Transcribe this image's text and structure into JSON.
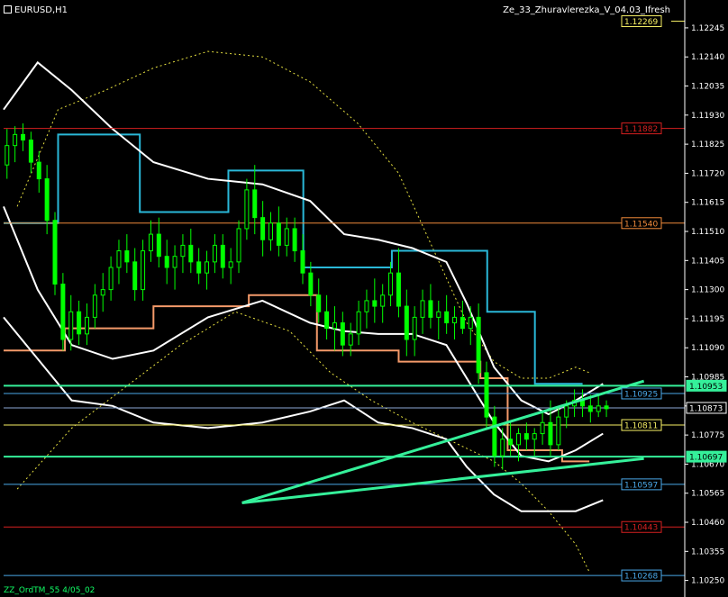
{
  "header": {
    "symbol": "EURUSD,H1",
    "indicator": "Ze_33_Zhuravlerezka_V_04.03_Ifresh"
  },
  "footer": {
    "label": "ZZ_OrdTM_55 4/05_02"
  },
  "colors": {
    "background": "#000000",
    "candle": "#00ff00",
    "price_line": "#8da9d4",
    "level_red": "#d62020",
    "level_orange": "#f08a3a",
    "level_yellow": "#f7f065",
    "level_blue": "#4aa8e8",
    "level_green": "#35f09a",
    "cyan_step": "#2ab8d8",
    "orange_step": "#f49a6a",
    "yellow_marker": "#ffff00",
    "envelope": "#ffffff",
    "dotted": "#e6e040",
    "trend": "#35f09a"
  },
  "chart_data": {
    "type": "candlestick",
    "symbol": "EURUSD",
    "timeframe": "H1",
    "ylim": [
      1.102,
      1.123
    ],
    "yticks": [
      "1.12245",
      "1.12140",
      "1.12035",
      "1.11930",
      "1.11825",
      "1.11720",
      "1.11615",
      "1.11510",
      "1.11405",
      "1.11300",
      "1.11195",
      "1.11090",
      "1.10985",
      "1.10880",
      "1.10775",
      "1.10670",
      "1.10565",
      "1.10460",
      "1.10355",
      "1.10250"
    ],
    "current_price": "1.10873",
    "price_labels": [
      {
        "value": "1.12269",
        "color": "#f7f065"
      },
      {
        "value": "1.11882",
        "color": "#d62020"
      },
      {
        "value": "1.11540",
        "color": "#f08a3a"
      },
      {
        "value": "1.10953",
        "color": "#35f09a"
      },
      {
        "value": "1.10925",
        "color": "#4aa8e8"
      },
      {
        "value": "1.10873",
        "color": "#ffffff"
      },
      {
        "value": "1.10811",
        "color": "#f7f065"
      },
      {
        "value": "1.10697",
        "color": "#35f09a"
      },
      {
        "value": "1.10597",
        "color": "#4aa8e8"
      },
      {
        "value": "1.10443",
        "color": "#d62020"
      },
      {
        "value": "1.10268",
        "color": "#4aa8e8"
      }
    ],
    "levels": [
      {
        "price": 1.12269,
        "color": "#f7f065",
        "style": "solid",
        "from": 0.98
      },
      {
        "price": 1.11882,
        "color": "#d62020",
        "style": "solid"
      },
      {
        "price": 1.1154,
        "color": "#f08a3a",
        "style": "solid"
      },
      {
        "price": 1.10953,
        "color": "#35f09a",
        "style": "solid"
      },
      {
        "price": 1.10925,
        "color": "#4aa8e8",
        "style": "solid"
      },
      {
        "price": 1.10873,
        "color": "#8da9d4",
        "style": "solid"
      },
      {
        "price": 1.10811,
        "color": "#f7f065",
        "style": "solid"
      },
      {
        "price": 1.10697,
        "color": "#35f09a",
        "style": "solid"
      },
      {
        "price": 1.10597,
        "color": "#4aa8e8",
        "style": "solid"
      },
      {
        "price": 1.10443,
        "color": "#d62020",
        "style": "solid"
      },
      {
        "price": 1.10268,
        "color": "#4aa8e8",
        "style": "solid"
      }
    ],
    "candles": [
      [
        1.1175,
        1.1188,
        1.117,
        1.1182
      ],
      [
        1.1182,
        1.1189,
        1.1176,
        1.1186
      ],
      [
        1.1186,
        1.119,
        1.118,
        1.1184
      ],
      [
        1.1184,
        1.1187,
        1.1172,
        1.1176
      ],
      [
        1.1176,
        1.118,
        1.1165,
        1.117
      ],
      [
        1.117,
        1.1175,
        1.115,
        1.1155
      ],
      [
        1.1155,
        1.1158,
        1.1128,
        1.1132
      ],
      [
        1.1132,
        1.1136,
        1.1108,
        1.1112
      ],
      [
        1.1112,
        1.1128,
        1.1108,
        1.1122
      ],
      [
        1.1122,
        1.1126,
        1.111,
        1.1114
      ],
      [
        1.1114,
        1.1125,
        1.111,
        1.112
      ],
      [
        1.112,
        1.1132,
        1.1116,
        1.1128
      ],
      [
        1.1128,
        1.1136,
        1.1122,
        1.113
      ],
      [
        1.113,
        1.1142,
        1.1126,
        1.1138
      ],
      [
        1.1138,
        1.1148,
        1.1132,
        1.1144
      ],
      [
        1.1144,
        1.115,
        1.1136,
        1.114
      ],
      [
        1.114,
        1.1145,
        1.1126,
        1.113
      ],
      [
        1.113,
        1.1148,
        1.1126,
        1.1144
      ],
      [
        1.1144,
        1.1155,
        1.114,
        1.115
      ],
      [
        1.115,
        1.1156,
        1.1138,
        1.1142
      ],
      [
        1.1142,
        1.1148,
        1.1132,
        1.1138
      ],
      [
        1.1138,
        1.1146,
        1.113,
        1.1142
      ],
      [
        1.1142,
        1.115,
        1.1136,
        1.1146
      ],
      [
        1.1146,
        1.1152,
        1.1136,
        1.114
      ],
      [
        1.114,
        1.1145,
        1.1132,
        1.1136
      ],
      [
        1.1136,
        1.1144,
        1.113,
        1.114
      ],
      [
        1.114,
        1.115,
        1.1136,
        1.1146
      ],
      [
        1.1146,
        1.115,
        1.1134,
        1.1138
      ],
      [
        1.1138,
        1.1145,
        1.1132,
        1.114
      ],
      [
        1.114,
        1.1155,
        1.1136,
        1.1152
      ],
      [
        1.1152,
        1.117,
        1.1148,
        1.1166
      ],
      [
        1.1166,
        1.1175,
        1.115,
        1.1156
      ],
      [
        1.1156,
        1.1162,
        1.1142,
        1.1148
      ],
      [
        1.1148,
        1.1158,
        1.1144,
        1.1154
      ],
      [
        1.1154,
        1.116,
        1.1142,
        1.1146
      ],
      [
        1.1146,
        1.1156,
        1.1142,
        1.1152
      ],
      [
        1.1152,
        1.1156,
        1.114,
        1.1144
      ],
      [
        1.1144,
        1.115,
        1.1132,
        1.1136
      ],
      [
        1.1136,
        1.114,
        1.1124,
        1.1128
      ],
      [
        1.1128,
        1.1134,
        1.1118,
        1.1122
      ],
      [
        1.1122,
        1.1128,
        1.1112,
        1.1116
      ],
      [
        1.1116,
        1.1124,
        1.1108,
        1.1118
      ],
      [
        1.1118,
        1.1122,
        1.1106,
        1.111
      ],
      [
        1.111,
        1.1118,
        1.1106,
        1.1114
      ],
      [
        1.1114,
        1.1126,
        1.111,
        1.1122
      ],
      [
        1.1122,
        1.113,
        1.1116,
        1.1126
      ],
      [
        1.1126,
        1.1134,
        1.1118,
        1.1124
      ],
      [
        1.1124,
        1.1132,
        1.1118,
        1.1128
      ],
      [
        1.1128,
        1.114,
        1.1124,
        1.1136
      ],
      [
        1.1136,
        1.1145,
        1.112,
        1.1124
      ],
      [
        1.1124,
        1.113,
        1.1106,
        1.1112
      ],
      [
        1.1112,
        1.1124,
        1.1106,
        1.112
      ],
      [
        1.112,
        1.113,
        1.1114,
        1.1126
      ],
      [
        1.1126,
        1.1132,
        1.1116,
        1.112
      ],
      [
        1.112,
        1.1126,
        1.1112,
        1.1122
      ],
      [
        1.1122,
        1.1128,
        1.1114,
        1.1118
      ],
      [
        1.1118,
        1.1124,
        1.1112,
        1.112
      ],
      [
        1.112,
        1.1126,
        1.1114,
        1.1116
      ],
      [
        1.1116,
        1.1124,
        1.111,
        1.112
      ],
      [
        1.112,
        1.1125,
        1.1096,
        1.11
      ],
      [
        1.11,
        1.1104,
        1.108,
        1.1084
      ],
      [
        1.1084,
        1.1088,
        1.1066,
        1.107
      ],
      [
        1.107,
        1.108,
        1.1065,
        1.1076
      ],
      [
        1.1076,
        1.1082,
        1.107,
        1.1074
      ],
      [
        1.1074,
        1.108,
        1.1068,
        1.1078
      ],
      [
        1.1078,
        1.1082,
        1.1072,
        1.1076
      ],
      [
        1.1076,
        1.108,
        1.107,
        1.1078
      ],
      [
        1.1078,
        1.1086,
        1.1074,
        1.1082
      ],
      [
        1.1082,
        1.109,
        1.107,
        1.1074
      ],
      [
        1.1074,
        1.1088,
        1.1072,
        1.1084
      ],
      [
        1.1084,
        1.109,
        1.108,
        1.1088
      ],
      [
        1.1088,
        1.1094,
        1.1084,
        1.109
      ],
      [
        1.109,
        1.1094,
        1.1084,
        1.1088
      ],
      [
        1.1088,
        1.1092,
        1.1082,
        1.1086
      ],
      [
        1.1086,
        1.1092,
        1.1084,
        1.1088
      ],
      [
        1.1088,
        1.109,
        1.1084,
        1.1087
      ]
    ],
    "cyan_steps": [
      [
        0,
        0.08,
        1.1154
      ],
      [
        0.08,
        0.2,
        1.1186
      ],
      [
        0.2,
        0.33,
        1.1158
      ],
      [
        0.33,
        0.44,
        1.1173
      ],
      [
        0.44,
        0.57,
        1.1138
      ],
      [
        0.57,
        0.71,
        1.1144
      ],
      [
        0.71,
        0.78,
        1.1122
      ],
      [
        0.78,
        0.85,
        1.1096
      ]
    ],
    "orange_steps": [
      [
        0,
        0.09,
        1.1108
      ],
      [
        0.09,
        0.22,
        1.1116
      ],
      [
        0.22,
        0.36,
        1.1124
      ],
      [
        0.36,
        0.46,
        1.1128
      ],
      [
        0.46,
        0.58,
        1.1108
      ],
      [
        0.58,
        0.7,
        1.1104
      ],
      [
        0.7,
        0.74,
        1.1098
      ],
      [
        0.74,
        0.82,
        1.1072
      ],
      [
        0.82,
        0.86,
        1.1068
      ]
    ],
    "upper_envelope": [
      [
        0,
        1.1195
      ],
      [
        0.05,
        1.1212
      ],
      [
        0.1,
        1.1202
      ],
      [
        0.16,
        1.1188
      ],
      [
        0.22,
        1.1176
      ],
      [
        0.3,
        1.117
      ],
      [
        0.38,
        1.1168
      ],
      [
        0.45,
        1.1162
      ],
      [
        0.5,
        1.115
      ],
      [
        0.55,
        1.1148
      ],
      [
        0.6,
        1.1145
      ],
      [
        0.65,
        1.114
      ],
      [
        0.68,
        1.1125
      ],
      [
        0.72,
        1.1102
      ],
      [
        0.76,
        1.109
      ],
      [
        0.8,
        1.1085
      ],
      [
        0.84,
        1.109
      ],
      [
        0.88,
        1.1096
      ]
    ],
    "mid_envelope": [
      [
        0,
        1.116
      ],
      [
        0.05,
        1.113
      ],
      [
        0.1,
        1.111
      ],
      [
        0.16,
        1.1105
      ],
      [
        0.22,
        1.1108
      ],
      [
        0.3,
        1.112
      ],
      [
        0.38,
        1.1126
      ],
      [
        0.45,
        1.1118
      ],
      [
        0.5,
        1.1115
      ],
      [
        0.55,
        1.1114
      ],
      [
        0.6,
        1.1114
      ],
      [
        0.65,
        1.111
      ],
      [
        0.68,
        1.1098
      ],
      [
        0.72,
        1.1082
      ],
      [
        0.76,
        1.107
      ],
      [
        0.8,
        1.1068
      ],
      [
        0.84,
        1.1072
      ],
      [
        0.88,
        1.1078
      ]
    ],
    "lower_envelope": [
      [
        0,
        1.112
      ],
      [
        0.05,
        1.1105
      ],
      [
        0.1,
        1.109
      ],
      [
        0.16,
        1.1088
      ],
      [
        0.22,
        1.1082
      ],
      [
        0.3,
        1.108
      ],
      [
        0.38,
        1.1082
      ],
      [
        0.45,
        1.1086
      ],
      [
        0.5,
        1.109
      ],
      [
        0.55,
        1.1082
      ],
      [
        0.6,
        1.108
      ],
      [
        0.65,
        1.1076
      ],
      [
        0.68,
        1.1066
      ],
      [
        0.72,
        1.1056
      ],
      [
        0.76,
        1.105
      ],
      [
        0.8,
        1.105
      ],
      [
        0.84,
        1.105
      ],
      [
        0.88,
        1.1054
      ]
    ],
    "dotted_curve": [
      [
        0.02,
        1.116
      ],
      [
        0.08,
        1.1195
      ],
      [
        0.15,
        1.1202
      ],
      [
        0.22,
        1.121
      ],
      [
        0.3,
        1.1216
      ],
      [
        0.38,
        1.1214
      ],
      [
        0.45,
        1.1205
      ],
      [
        0.52,
        1.119
      ],
      [
        0.58,
        1.1172
      ],
      [
        0.63,
        1.1145
      ],
      [
        0.68,
        1.1118
      ],
      [
        0.72,
        1.1104
      ],
      [
        0.76,
        1.1098
      ],
      [
        0.8,
        1.1098
      ],
      [
        0.84,
        1.1102
      ],
      [
        0.86,
        1.11
      ]
    ],
    "dotted_curve_low": [
      [
        0.02,
        1.1058
      ],
      [
        0.1,
        1.108
      ],
      [
        0.18,
        1.1095
      ],
      [
        0.26,
        1.111
      ],
      [
        0.34,
        1.1122
      ],
      [
        0.42,
        1.1115
      ],
      [
        0.48,
        1.11
      ],
      [
        0.54,
        1.109
      ],
      [
        0.6,
        1.1082
      ],
      [
        0.66,
        1.1075
      ],
      [
        0.72,
        1.1068
      ],
      [
        0.76,
        1.106
      ],
      [
        0.8,
        1.105
      ],
      [
        0.84,
        1.1038
      ],
      [
        0.86,
        1.1028
      ]
    ],
    "trendlines": [
      {
        "from": [
          0.35,
          1.1053
        ],
        "to": [
          0.94,
          1.1097
        ]
      },
      {
        "from": [
          0.35,
          1.1053
        ],
        "to": [
          0.94,
          1.1069
        ]
      }
    ],
    "grid": false
  }
}
